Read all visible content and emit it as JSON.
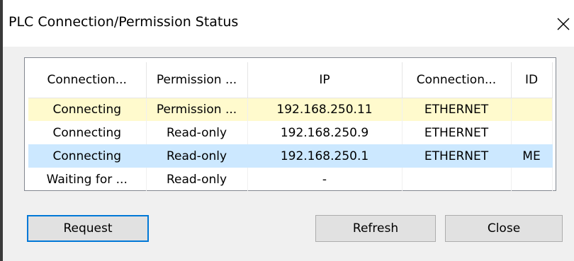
{
  "dialog": {
    "title": "PLC Connection/Permission Status",
    "close_icon": "close-icon"
  },
  "table": {
    "columns": [
      "Connection...",
      "Permission ...",
      "IP",
      "Connection...",
      "ID"
    ],
    "rows": [
      {
        "status": "Connecting",
        "permission": "Permission ...",
        "ip": "192.168.250.11",
        "type": "ETHERNET",
        "id": "",
        "highlight": "#fffacd"
      },
      {
        "status": "Connecting",
        "permission": "Read-only",
        "ip": "192.168.250.9",
        "type": "ETHERNET",
        "id": "",
        "highlight": ""
      },
      {
        "status": "Connecting",
        "permission": "Read-only",
        "ip": "192.168.250.1",
        "type": "ETHERNET",
        "id": "ME",
        "highlight": "#cce8ff"
      },
      {
        "status": "Waiting for ...",
        "permission": "Read-only",
        "ip": "-",
        "type": "",
        "id": "",
        "highlight": ""
      }
    ]
  },
  "buttons": {
    "request": "Request",
    "refresh": "Refresh",
    "close": "Close"
  },
  "colors": {
    "focus_border": "#0078d7",
    "selected_row": "#cce8ff",
    "pending_row": "#fffacd"
  }
}
